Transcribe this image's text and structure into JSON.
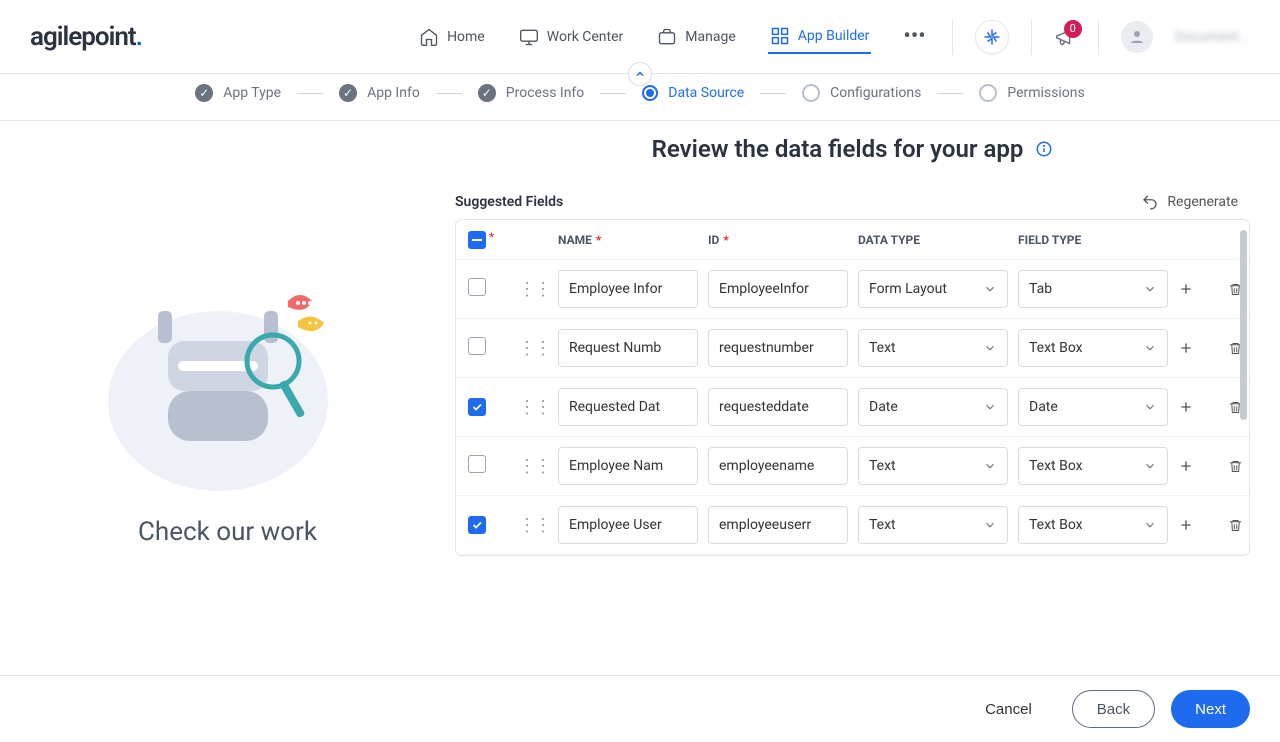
{
  "brand": "agilepoint",
  "nav": {
    "home": "Home",
    "work_center": "Work Center",
    "manage": "Manage",
    "app_builder": "App Builder"
  },
  "notifications": {
    "count": "0"
  },
  "user": {
    "name": "Document..."
  },
  "wizard": {
    "steps": [
      {
        "label": "App Type",
        "state": "done"
      },
      {
        "label": "App Info",
        "state": "done"
      },
      {
        "label": "Process Info",
        "state": "done"
      },
      {
        "label": "Data Source",
        "state": "current"
      },
      {
        "label": "Configurations",
        "state": "future"
      },
      {
        "label": "Permissions",
        "state": "future"
      }
    ]
  },
  "illustration_caption": "Check our work",
  "title": "Review the data fields for your app",
  "section_label": "Suggested Fields",
  "regenerate_label": "Regenerate",
  "columns": {
    "name": "NAME",
    "id": "ID",
    "data_type": "DATA TYPE",
    "field_type": "FIELD TYPE"
  },
  "rows": [
    {
      "checked": false,
      "name": "Employee Infor",
      "id": "EmployeeInfor",
      "data_type": "Form Layout",
      "field_type": "Tab"
    },
    {
      "checked": false,
      "name": "Request Numb",
      "id": "requestnumber",
      "data_type": "Text",
      "field_type": "Text Box"
    },
    {
      "checked": true,
      "name": "Requested Dat",
      "id": "requesteddate",
      "data_type": "Date",
      "field_type": "Date"
    },
    {
      "checked": false,
      "name": "Employee Nam",
      "id": "employeename",
      "data_type": "Text",
      "field_type": "Text Box"
    },
    {
      "checked": true,
      "name": "Employee User",
      "id": "employeeuserr",
      "data_type": "Text",
      "field_type": "Text Box"
    }
  ],
  "footer": {
    "cancel": "Cancel",
    "back": "Back",
    "next": "Next"
  }
}
